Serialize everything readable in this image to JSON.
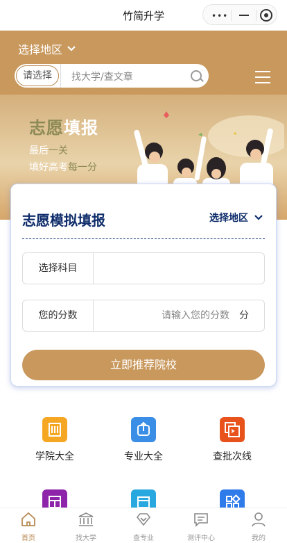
{
  "app": {
    "title": "竹简升学"
  },
  "header": {
    "region_label": "选择地区",
    "search_select": "请选择",
    "search_placeholder": "找大学/查文章"
  },
  "banner": {
    "title_part1": "志愿",
    "title_part2": "填报",
    "line1_a": "最后",
    "line1_b": "一关",
    "line2_a": "填好高考",
    "line2_b": "每一分"
  },
  "card": {
    "title": "志愿模拟填报",
    "region_label": "选择地区",
    "subject_label": "选择科目",
    "score_label": "您的分数",
    "score_placeholder": "请输入您的分数",
    "score_unit": "分",
    "submit_label": "立即推荐院校"
  },
  "features": [
    {
      "label": "学院大全",
      "icon": "building-icon",
      "color": "#f5a623"
    },
    {
      "label": "专业大全",
      "icon": "upload-box-icon",
      "color": "#3a8ee6"
    },
    {
      "label": "查批次线",
      "icon": "terminal-stack-icon",
      "color": "#e8531c"
    },
    {
      "label": "",
      "icon": "grid-icon",
      "color": "#8e24aa"
    },
    {
      "label": "",
      "icon": "calendar-icon",
      "color": "#29a8e0"
    },
    {
      "label": "",
      "icon": "apps-icon",
      "color": "#2f7bea"
    }
  ],
  "tabs": [
    {
      "label": "首页",
      "icon": "home-icon",
      "active": true
    },
    {
      "label": "找大学",
      "icon": "university-icon",
      "active": false
    },
    {
      "label": "查专业",
      "icon": "diamond-icon",
      "active": false
    },
    {
      "label": "测评中心",
      "icon": "message-icon",
      "active": false
    },
    {
      "label": "我的",
      "icon": "user-icon",
      "active": false
    }
  ],
  "colors": {
    "brand": "#c9985d",
    "navy": "#0f2d6b",
    "accent_text": "#8c8a56"
  }
}
